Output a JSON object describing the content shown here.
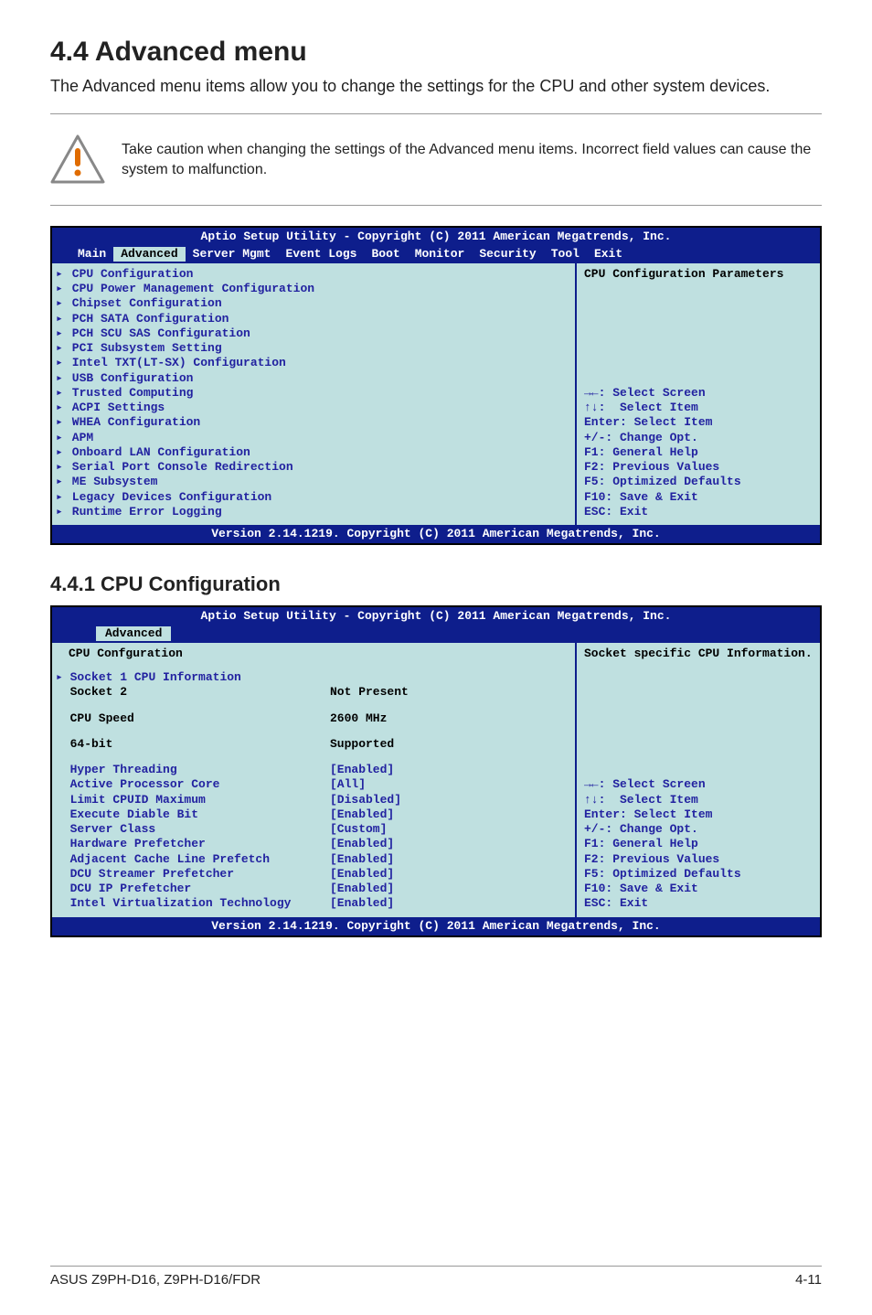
{
  "section": {
    "number_title": "4.4   Advanced menu",
    "intro": "The Advanced menu items allow you to change the settings for the CPU and other system devices."
  },
  "note": "Take caution when changing the settings of the Advanced menu items. Incorrect field values can cause the system to malfunction.",
  "bios1": {
    "top_title": "Aptio Setup Utility - Copyright (C) 2011 American Megatrends, Inc.",
    "tabs": [
      "Main",
      "Advanced",
      "Server Mgmt",
      "Event Logs",
      "Boot",
      "Monitor",
      "Security",
      "Tool",
      "Exit"
    ],
    "active_tab": "Advanced",
    "menu": [
      "CPU Configuration",
      "CPU Power Management Configuration",
      "Chipset Configuration",
      "PCH SATA Configuration",
      "PCH SCU SAS Configuration",
      "PCI Subsystem Setting",
      "Intel TXT(LT-SX) Configuration",
      "USB Configuration",
      "Trusted Computing",
      "ACPI Settings",
      "WHEA Configuration",
      "APM",
      "Onboard LAN Configuration",
      "Serial Port Console Redirection",
      "ME Subsystem",
      "Legacy Devices Configuration",
      "Runtime Error Logging"
    ],
    "help_top": "CPU Configuration Parameters",
    "legend": [
      "→←: Select Screen",
      "↑↓:  Select Item",
      "Enter: Select Item",
      "+/-: Change Opt.",
      "F1: General Help",
      "F2: Previous Values",
      "F5: Optimized Defaults",
      "F10: Save & Exit",
      "ESC: Exit"
    ],
    "footer": "Version 2.14.1219. Copyright (C) 2011 American Megatrends, Inc."
  },
  "sub": {
    "title": "4.4.1    CPU Configuration"
  },
  "bios2": {
    "top_title": "Aptio Setup Utility - Copyright (C) 2011 American Megatrends, Inc.",
    "tab": "Advanced",
    "heading": "CPU Confguration",
    "rows": [
      {
        "label": "Socket 1 CPU Information",
        "value": "",
        "arrow": true,
        "blue": true
      },
      {
        "label": "Socket 2",
        "value": "Not Present",
        "arrow": false,
        "blue": false,
        "black": true
      },
      {
        "spacer": true
      },
      {
        "label": "CPU Speed",
        "value": "2600 MHz",
        "arrow": false,
        "black": true
      },
      {
        "spacer": true
      },
      {
        "label": "64-bit",
        "value": "Supported",
        "arrow": false,
        "black": true
      },
      {
        "spacer": true
      },
      {
        "label": "Hyper Threading",
        "value": "[Enabled]",
        "blue": true
      },
      {
        "label": "Active Processor Core",
        "value": "[All]",
        "blue": true
      },
      {
        "label": "Limit CPUID Maximum",
        "value": "[Disabled]",
        "blue": true
      },
      {
        "label": "Execute Diable Bit",
        "value": "[Enabled]",
        "blue": true
      },
      {
        "label": "Server Class",
        "value": "[Custom]",
        "blue": true
      },
      {
        "label": "Hardware Prefetcher",
        "value": "[Enabled]",
        "blue": true
      },
      {
        "label": "Adjacent Cache Line Prefetch",
        "value": "[Enabled]",
        "blue": true
      },
      {
        "label": "DCU Streamer Prefetcher",
        "value": "[Enabled]",
        "blue": true
      },
      {
        "label": "DCU IP Prefetcher",
        "value": "[Enabled]",
        "blue": true
      },
      {
        "label": "Intel Virtualization Technology",
        "value": "[Enabled]",
        "blue": true
      }
    ],
    "help_top": "Socket specific CPU Information.",
    "legend": [
      "→←: Select Screen",
      "↑↓:  Select Item",
      "Enter: Select Item",
      "+/-: Change Opt.",
      "F1: General Help",
      "F2: Previous Values",
      "F5: Optimized Defaults",
      "F10: Save & Exit",
      "ESC: Exit"
    ],
    "footer": "Version 2.14.1219. Copyright (C) 2011 American Megatrends, Inc."
  },
  "footer": {
    "left": "ASUS Z9PH-D16, Z9PH-D16/FDR",
    "right": "4-11"
  }
}
